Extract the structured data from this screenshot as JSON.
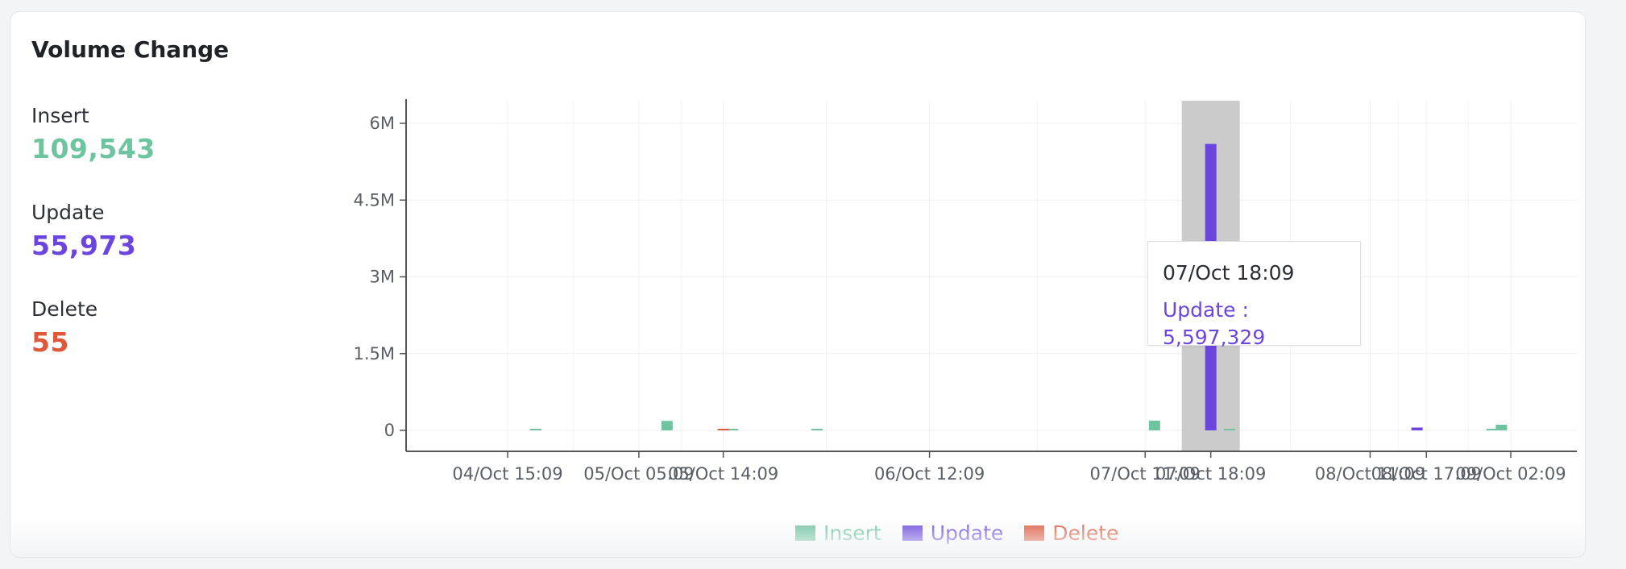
{
  "card": {
    "title": "Volume Change"
  },
  "stats": [
    {
      "label": "Insert",
      "value": "109,543",
      "color": "#6dc49e"
    },
    {
      "label": "Update",
      "value": "55,973",
      "color": "#6b46de"
    },
    {
      "label": "Delete",
      "value": "55",
      "color": "#e0583a"
    }
  ],
  "tooltip": {
    "date": "07/Oct 18:09",
    "label": "Update",
    "value": "5,597,329"
  },
  "chart_data": {
    "type": "bar",
    "x_ticks": [
      "04/Oct 15:09",
      "05/Oct 05:09",
      "05/Oct 14:09",
      "06/Oct 12:09",
      "07/Oct 11:09",
      "07/Oct 18:09",
      "08/Oct 11:09",
      "08/Oct 17:09",
      "09/Oct 02:09"
    ],
    "y_ticks": [
      "0",
      "1.5M",
      "3M",
      "4.5M",
      "6M"
    ],
    "ylim": [
      0,
      6450000
    ],
    "grid": true,
    "legend": "bottom",
    "highlighted": "07/Oct 18:09",
    "series": [
      {
        "name": "Insert",
        "color": "#6dc49e",
        "points": [
          {
            "time": "04/Oct 18:09",
            "value": 1500
          },
          {
            "time": "05/Oct 08:09",
            "value": 185000
          },
          {
            "time": "05/Oct 15:09",
            "value": 12000
          },
          {
            "time": "06/Oct 00:09",
            "value": 40000
          },
          {
            "time": "07/Oct 12:09",
            "value": 190000
          },
          {
            "time": "07/Oct 20:09",
            "value": 45000
          },
          {
            "time": "09/Oct 00:09",
            "value": 2000
          },
          {
            "time": "09/Oct 01:09",
            "value": 110000
          }
        ]
      },
      {
        "name": "Update",
        "color": "#6b46de",
        "points": [
          {
            "time": "07/Oct 18:09",
            "value": 5597329
          },
          {
            "time": "08/Oct 16:09",
            "value": 55000
          }
        ]
      },
      {
        "name": "Delete",
        "color": "#e0583a",
        "points": [
          {
            "time": "05/Oct 14:09",
            "value": 2000
          }
        ]
      }
    ]
  }
}
